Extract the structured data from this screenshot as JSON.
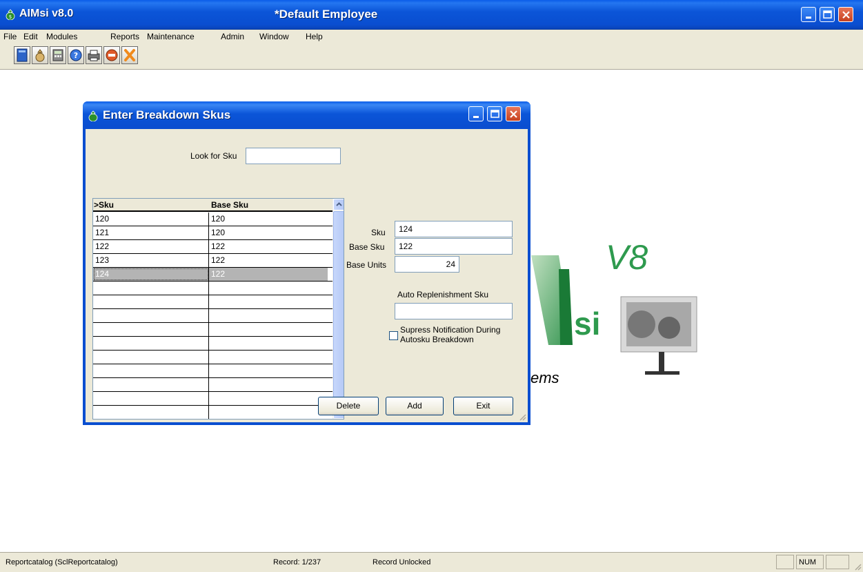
{
  "window": {
    "app_title": "AIMsi v8.0",
    "doc_title": "*Default Employee"
  },
  "menu": [
    "File",
    "Edit",
    "Modules",
    "Reports",
    "Maintenance",
    "Admin",
    "Window",
    "Help"
  ],
  "toolbar": {
    "icons": [
      "book-icon",
      "bag-icon",
      "calculator-icon",
      "help-icon",
      "printer-icon",
      "stop-icon",
      "exit-icon"
    ]
  },
  "logo": {
    "version": "V8",
    "letters": "si",
    "tagline": "ems"
  },
  "dialog": {
    "title": "Enter Breakdown Skus",
    "look_for_label": "Look for Sku",
    "look_for_value": "",
    "grid": {
      "headers": [
        ">Sku",
        "Base Sku"
      ],
      "rows": [
        [
          "120",
          "120"
        ],
        [
          "121",
          "120"
        ],
        [
          "122",
          "122"
        ],
        [
          "123",
          "122"
        ],
        [
          "124",
          "122"
        ]
      ],
      "selected_index": 4
    },
    "form": {
      "sku_label": "Sku",
      "sku_value": "124",
      "base_sku_label": "Base Sku",
      "base_sku_value": "122",
      "base_units_label": "Base Units",
      "base_units_value": "24",
      "auto_replenish_label": "Auto Replenishment Sku",
      "auto_replenish_value": "",
      "supress_label_1": "Supress Notification During",
      "supress_label_2": "Autosku Breakdown",
      "supress_checked": false
    },
    "buttons": {
      "delete": "Delete",
      "add": "Add",
      "exit": "Exit"
    }
  },
  "status": {
    "left": "Reportcatalog (SclReportcatalog)",
    "record": "Record: 1/237",
    "lock": "Record Unlocked",
    "num": "NUM"
  },
  "colors": {
    "titlebar": "#0a4ed0",
    "face": "#ece9d8",
    "logo_green": "#2e9a4e"
  }
}
